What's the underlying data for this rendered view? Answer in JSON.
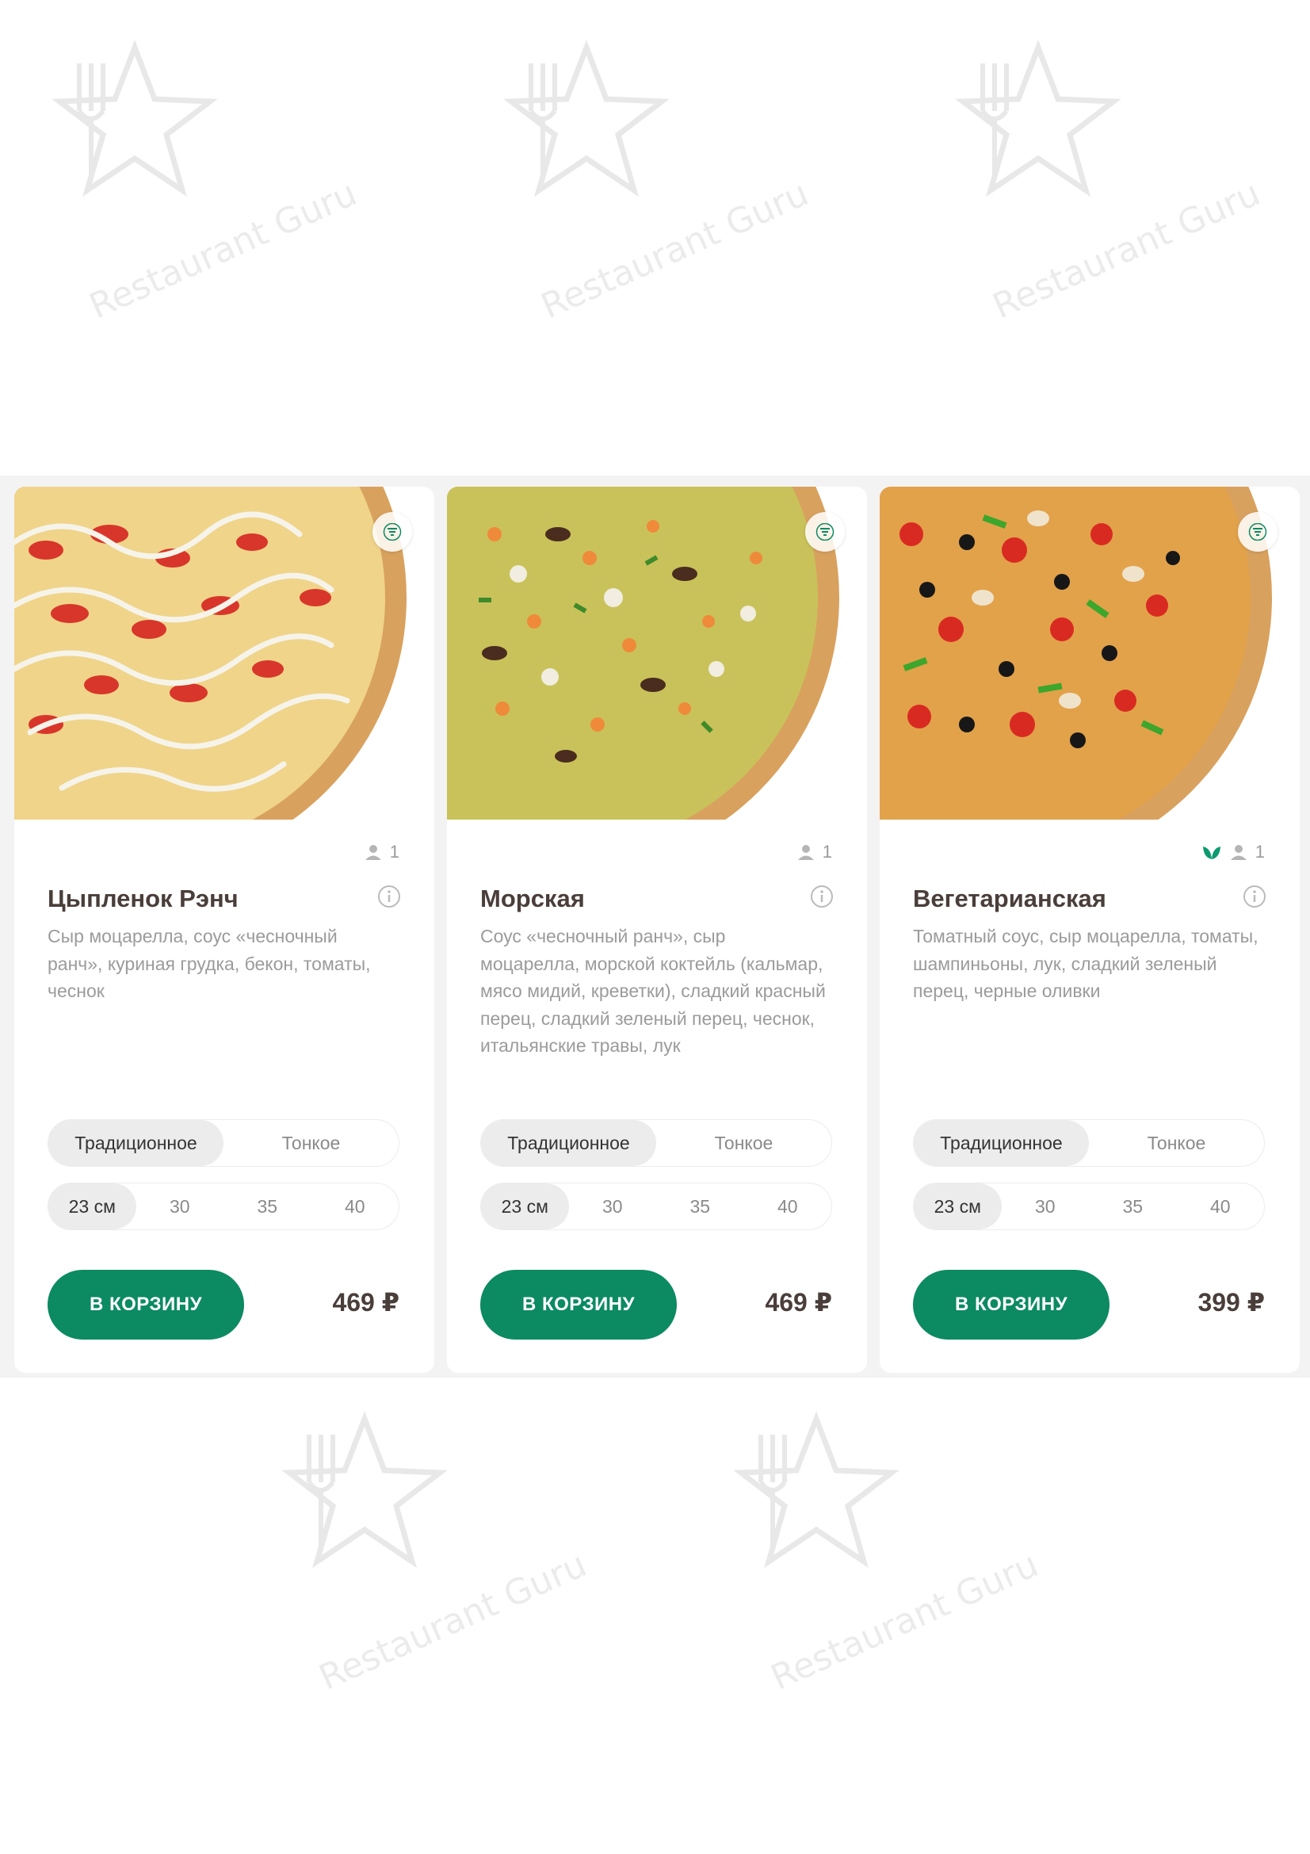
{
  "watermark": {
    "text": "Restaurant Guru",
    "icon": "star-fork-icon"
  },
  "colors": {
    "accent": "#0c8a62",
    "title": "#4a3e3a",
    "muted": "#9b9b9b",
    "veg_leaf": "#0c9a6e"
  },
  "products": [
    {
      "name": "Цыпленок Рэнч",
      "description": "Сыр моцарелла, соус «чесночный ранч», куриная грудка, бекон, томаты, чеснок",
      "persons": "1",
      "vegetarian": false,
      "dough_options": [
        "Традиционное",
        "Тонкое"
      ],
      "dough_selected": "Традиционное",
      "sizes": [
        "23 см",
        "30",
        "35",
        "40"
      ],
      "size_selected": "23 см",
      "cart_label": "В КОРЗИНУ",
      "price": "469 ₽",
      "image": "chicken-ranch-pizza"
    },
    {
      "name": "Морская",
      "description": "Соус «чесночный ранч», сыр моцарелла, морской коктейль (кальмар, мясо мидий, креветки), сладкий красный перец, сладкий зеленый перец, чеснок, итальянские травы, лук",
      "persons": "1",
      "vegetarian": false,
      "dough_options": [
        "Традиционное",
        "Тонкое"
      ],
      "dough_selected": "Традиционное",
      "sizes": [
        "23 см",
        "30",
        "35",
        "40"
      ],
      "size_selected": "23 см",
      "cart_label": "В КОРЗИНУ",
      "price": "469 ₽",
      "image": "seafood-pizza"
    },
    {
      "name": "Вегетарианская",
      "description": "Томатный соус, сыр моцарелла, томаты, шампиньоны, лук, сладкий зеленый перец, черные оливки",
      "persons": "1",
      "vegetarian": true,
      "dough_options": [
        "Традиционное",
        "Тонкое"
      ],
      "dough_selected": "Традиционное",
      "sizes": [
        "23 см",
        "30",
        "35",
        "40"
      ],
      "size_selected": "23 см",
      "cart_label": "В КОРЗИНУ",
      "price": "399 ₽",
      "image": "vegetarian-pizza"
    }
  ]
}
